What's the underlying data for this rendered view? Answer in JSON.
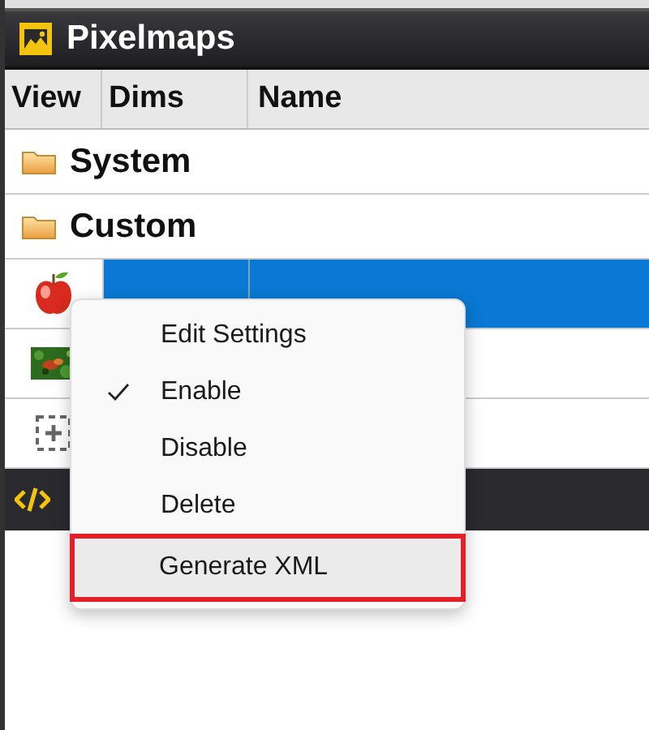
{
  "panel": {
    "title": "Pixelmaps"
  },
  "table": {
    "columns": [
      "View",
      "Dims",
      "Name"
    ],
    "rows": [
      {
        "kind": "folder",
        "label": "System"
      },
      {
        "kind": "folder",
        "label": "Custom"
      },
      {
        "kind": "pixelmap",
        "selected": true
      },
      {
        "kind": "pixelmap",
        "selected": false
      },
      {
        "kind": "add"
      }
    ]
  },
  "context_menu": {
    "items": [
      {
        "label": "Edit Settings",
        "checked": false,
        "selected": false,
        "annotated": false
      },
      {
        "label": "Enable",
        "checked": true,
        "selected": false,
        "annotated": false
      },
      {
        "label": "Disable",
        "checked": false,
        "selected": false,
        "annotated": false
      },
      {
        "label": "Delete",
        "checked": false,
        "selected": false,
        "annotated": false
      },
      {
        "label": "Generate XML",
        "checked": false,
        "selected": true,
        "annotated": true
      }
    ]
  }
}
